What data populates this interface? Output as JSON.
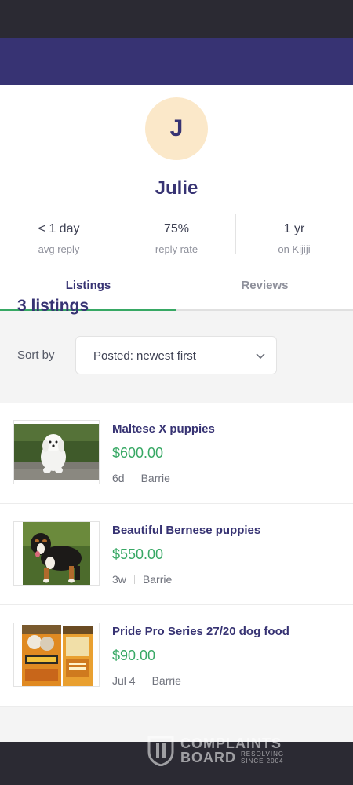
{
  "profile": {
    "avatar_letter": "J",
    "name": "Julie",
    "stats": [
      {
        "value": "< 1 day",
        "label": "avg reply"
      },
      {
        "value": "75%",
        "label": "reply rate"
      },
      {
        "value": "1 yr",
        "label": "on Kijiji"
      }
    ]
  },
  "tabs": [
    {
      "label": "Listings",
      "active": true
    },
    {
      "label": "Reviews",
      "active": false
    }
  ],
  "listings_header": {
    "count_label": "3 listings",
    "sort_label": "Sort by",
    "sort_value": "Posted: newest first"
  },
  "listings": [
    {
      "title": "Maltese X puppies",
      "price": "$600.00",
      "age": "6d",
      "location": "Barrie",
      "image": "white-puppy-photo"
    },
    {
      "title": "Beautiful Bernese puppies",
      "price": "$550.00",
      "age": "3w",
      "location": "Barrie",
      "image": "bernese-puppy-photo"
    },
    {
      "title": "Pride Pro Series 27/20 dog food",
      "price": "$90.00",
      "age": "Jul 4",
      "location": "Barrie",
      "image": "dog-food-bag-photo"
    }
  ],
  "watermark": {
    "line1": "COMPLAINTS",
    "line2": "BOARD",
    "tag1": "RESOLVING",
    "tag2": "SINCE 2004"
  },
  "colors": {
    "brand": "#373373",
    "accent": "#37a864",
    "avatar_bg": "#fbe8c9"
  },
  "icons": {
    "sort_chevron": "chevron-down-icon"
  }
}
